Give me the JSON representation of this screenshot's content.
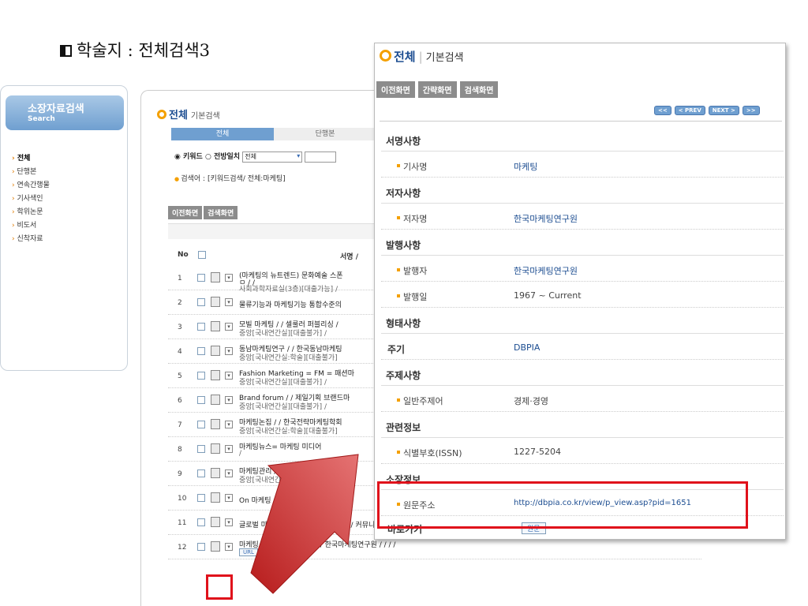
{
  "slide_title": "학술지 : 전체검색3",
  "sidebar": {
    "title": "소장자료검색",
    "subtitle": "Search",
    "items": [
      "전체",
      "단행본",
      "연속간행물",
      "기사색인",
      "학위논문",
      "비도서",
      "신착자료"
    ]
  },
  "bg": {
    "heading": "전체",
    "heading_sub": "기본검색",
    "tabs": [
      "전체",
      "단행본"
    ],
    "radio_keyword": "◉ 키워드",
    "radio_exact": "○ 전방일치",
    "select_value": "전체",
    "search_info": "검색어 : [키워드검색/ 전체:마케팅]",
    "btn_prev": "이전화면",
    "btn_search": "검색화면",
    "col_no": "No",
    "col_title": "서명 /",
    "rows": [
      {
        "no": "1",
        "l1": "(마케팅의 뉴트렌드) 문화예술 스폰",
        "l1b": "ㅁ / /",
        "l2": "사회과학자료실(3층)[대출가능] /"
      },
      {
        "no": "2",
        "l1": "물류기능과 마케팅기능 통합수준의",
        "l2": ""
      },
      {
        "no": "3",
        "l1": "모빌 마케팅 / / 셀룰러 퍼블리싱 /",
        "l2": "중앙[국내연간실][대출불가] /"
      },
      {
        "no": "4",
        "l1": "동남마케팅연구 / / 한국동남마케팅",
        "l2": "중앙[국내연간실:학술][대출불가]"
      },
      {
        "no": "5",
        "l1": "Fashion Marketing = FM = 패션마",
        "l2": "중앙[국내연간실][대출불가] /"
      },
      {
        "no": "6",
        "l1": "Brand forum / / 제일기획 브랜드마",
        "l2": "중앙[국내연간실][대출불가] /"
      },
      {
        "no": "7",
        "l1": "마케팅논집 / / 한국전략마케팅학회",
        "l2": "중앙[국내연간실:학술][대출불가]"
      },
      {
        "no": "8",
        "l1": "마케팅뉴스= 마케팅  미디어",
        "l2": "/"
      },
      {
        "no": "9",
        "l1": "마케팅관리 / / 한국마케팅관리",
        "l2": "중앙[국내연간실:학술][대출불가]"
      },
      {
        "no": "10",
        "l1": "On   마케팅 / 김영한 / 거름",
        "l2": ""
      },
      {
        "no": "11",
        "l1": "글로벌 마케팅 커뮤니케이션 / 김상훈 / 커뮤니케이션북스 / / / /",
        "l2": ""
      },
      {
        "no": "12",
        "l1": "마케팅 / 한국마케팅연구원 / 한국마케팅연구원 / / / /",
        "l2": "",
        "url": "URL"
      }
    ]
  },
  "popup": {
    "heading": "전체",
    "heading_sub": "기본검색",
    "buttons": [
      "이전화면",
      "간략화면",
      "검색화면"
    ],
    "pager": [
      "<<",
      "< PREV",
      "NEXT >",
      ">>"
    ],
    "sections": {
      "s1": "서명사항",
      "s1_k": "기사명",
      "s1_v": "마케팅",
      "s2": "저자사항",
      "s2_k": "저자명",
      "s2_v": "한국마케팅연구원",
      "s3": "발행사항",
      "s3_k1": "발행자",
      "s3_v1": "한국마케팅연구원",
      "s3_k2": "발행일",
      "s3_v2": "1967 ~ Current",
      "s4": "형태사항",
      "s4_k": "주기",
      "s4_v": "DBPIA",
      "s5": "주제사항",
      "s5_k": "일반주제어",
      "s5_v": "경제·경영",
      "s6": "관련정보",
      "s6_k": "식별부호(ISSN)",
      "s6_v": "1227-5204",
      "s7": "소장정보",
      "s7_k": "원문주소",
      "s7_v": "http://dbpia.co.kr/view/p_view.asp?pid=1651",
      "s8": "바로가기",
      "s8_btn": "원문"
    }
  },
  "colors": {
    "accent": "#1c4d91",
    "highlight": "#e0111b",
    "orange": "#f4a000",
    "arrow": "#c8302a"
  }
}
